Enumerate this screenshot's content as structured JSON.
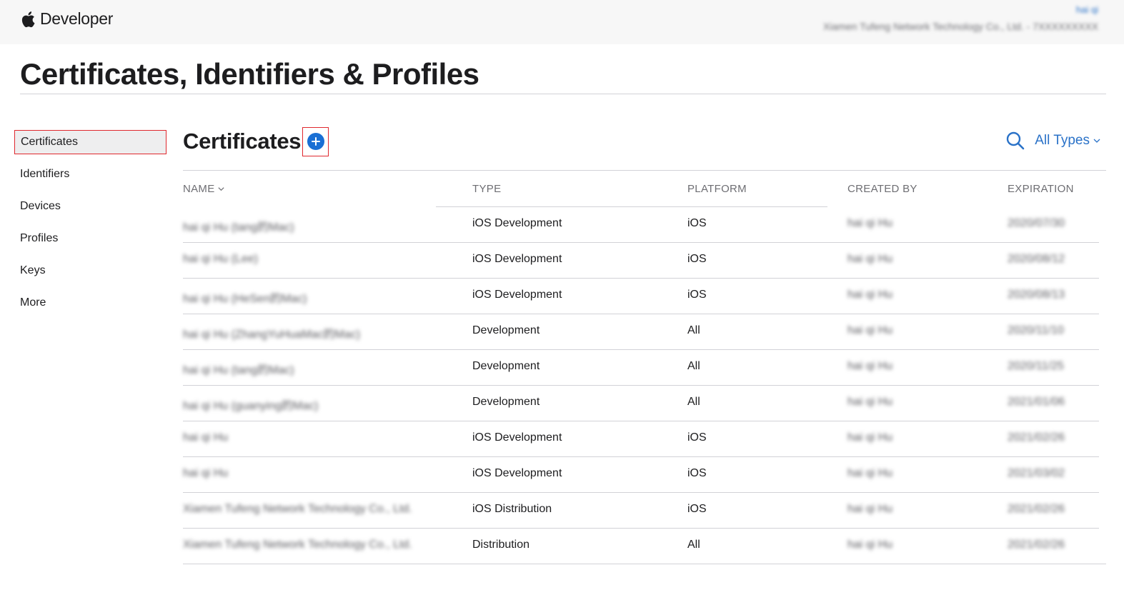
{
  "header": {
    "brand": "Developer",
    "account_user": "hai qi",
    "account_team": "Xiamen Tufeng Network Technology Co., Ltd. - 7XXXXXXXXX"
  },
  "page_title": "Certificates, Identifiers & Profiles",
  "sidebar": {
    "items": [
      {
        "label": "Certificates"
      },
      {
        "label": "Identifiers"
      },
      {
        "label": "Devices"
      },
      {
        "label": "Profiles"
      },
      {
        "label": "Keys"
      },
      {
        "label": "More"
      }
    ]
  },
  "section": {
    "title": "Certificates",
    "filter_label": "All Types"
  },
  "table": {
    "columns": {
      "name": "NAME",
      "type": "TYPE",
      "platform": "PLATFORM",
      "created_by": "CREATED BY",
      "expiration": "EXPIRATION"
    },
    "rows": [
      {
        "name": "hai qi Hu (tang的Mac)",
        "type": "iOS Development",
        "platform": "iOS",
        "created_by": "hai qi Hu",
        "expiration": "2020/07/30"
      },
      {
        "name": "hai qi Hu (Lee)",
        "type": "iOS Development",
        "platform": "iOS",
        "created_by": "hai qi Hu",
        "expiration": "2020/08/12"
      },
      {
        "name": "hai qi Hu (HeSen的Mac)",
        "type": "iOS Development",
        "platform": "iOS",
        "created_by": "hai qi Hu",
        "expiration": "2020/08/13"
      },
      {
        "name": "hai qi Hu (ZhangYuHuaMac的Mac)",
        "type": "Development",
        "platform": "All",
        "created_by": "hai qi Hu",
        "expiration": "2020/11/10"
      },
      {
        "name": "hai qi Hu (tang的Mac)",
        "type": "Development",
        "platform": "All",
        "created_by": "hai qi Hu",
        "expiration": "2020/11/25"
      },
      {
        "name": "hai qi Hu (guanying的Mac)",
        "type": "Development",
        "platform": "All",
        "created_by": "hai qi Hu",
        "expiration": "2021/01/06"
      },
      {
        "name": "hai qi Hu",
        "type": "iOS Development",
        "platform": "iOS",
        "created_by": "hai qi Hu",
        "expiration": "2021/02/26"
      },
      {
        "name": "hai qi Hu",
        "type": "iOS Development",
        "platform": "iOS",
        "created_by": "hai qi Hu",
        "expiration": "2021/03/02"
      },
      {
        "name": "Xiamen Tufeng Network Technology Co., Ltd.",
        "type": "iOS Distribution",
        "platform": "iOS",
        "created_by": "hai qi Hu",
        "expiration": "2021/02/26"
      },
      {
        "name": "Xiamen Tufeng Network Technology Co., Ltd.",
        "type": "Distribution",
        "platform": "All",
        "created_by": "hai qi Hu",
        "expiration": "2021/02/26"
      }
    ]
  }
}
